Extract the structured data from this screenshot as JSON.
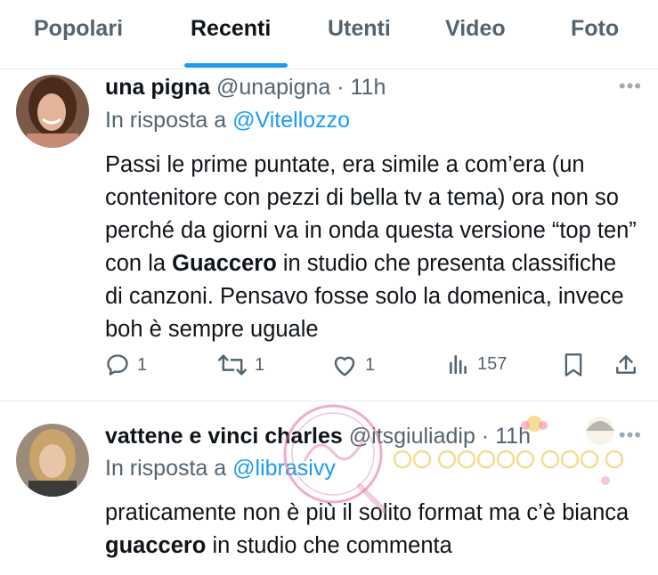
{
  "tabs": [
    "Popolari",
    "Recenti",
    "Utenti",
    "Video",
    "Foto"
  ],
  "active_tab": "Recenti",
  "accent_color": "#1d9bf0",
  "tweet1": {
    "name": "una pigna",
    "handle": "@unapigna",
    "time": "· 11h",
    "reply_prefix": "In risposta a",
    "reply_to": "@Vitellozzo",
    "text_before": "Passi le prime puntate, era simile a com’era (un contenitore con pezzi di bella tv a tema) ora non so perché da giorni va in onda questa versione “top ten” con la ",
    "text_bold": "Guaccero",
    "text_after": " in studio che presenta classifiche di canzoni. Pensavo fosse solo la domenica, invece boh è sempre uguale",
    "replies": "1",
    "retweets": "1",
    "likes": "1",
    "views": "157"
  },
  "tweet2": {
    "name": "vattene e vinci charles",
    "handle": "@itsgiuliadip",
    "time": "· 11h",
    "reply_prefix": "In risposta a",
    "reply_to": "@librasivy",
    "text_before": "praticamente non è più il solito format ma c’è bianca ",
    "text_bold": "guaccero",
    "text_after": " in studio che commenta"
  },
  "watermarks": {
    "stamp": "Nicolò della Kitty",
    "banner": "le faine del web"
  },
  "icons": [
    "more-icon",
    "reply-icon",
    "retweet-icon",
    "like-icon",
    "views-icon",
    "bookmark-icon",
    "share-icon"
  ]
}
